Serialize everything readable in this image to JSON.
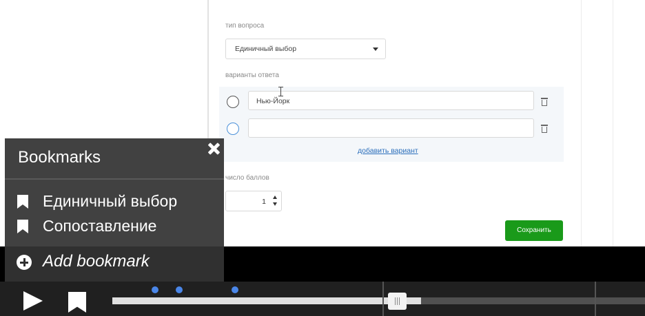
{
  "form": {
    "question_type_label": "тип вопроса",
    "question_type_value": "Единичный выбор",
    "answers_label": "варианты ответа",
    "answers": [
      {
        "text": "Нью-Йорк"
      },
      {
        "text": ""
      }
    ],
    "add_variant": "добавить вариант",
    "points_label": "число баллов",
    "points_value": "1",
    "save_label": "Сохранить"
  },
  "bookmarks": {
    "title": "Bookmarks",
    "items": [
      {
        "label": "Единичный выбор"
      },
      {
        "label": "Сопоставление"
      }
    ],
    "add_label": "Add bookmark"
  },
  "player": {
    "progress_fraction": 0.58,
    "marker_fractions": [
      0.08,
      0.125,
      0.23
    ],
    "accent_color": "#4a86e8"
  }
}
